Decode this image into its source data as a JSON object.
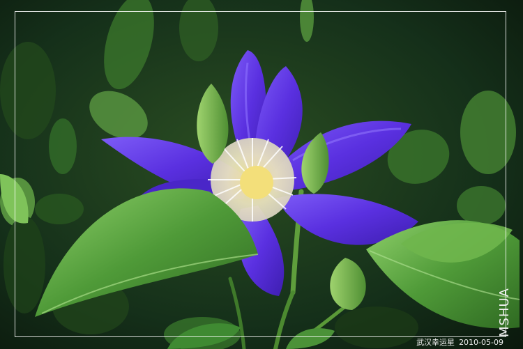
{
  "watermark": {
    "vertical_text": "MSHUA",
    "caption_text": "武汉幸运星",
    "caption_date": "2010-05-09"
  },
  "colors": {
    "petal": "#5a2fe0",
    "petal_highlight": "#8a6cff",
    "stamen": "#f1eec8",
    "leaf": "#4f9a38",
    "background": "#0f2410"
  }
}
